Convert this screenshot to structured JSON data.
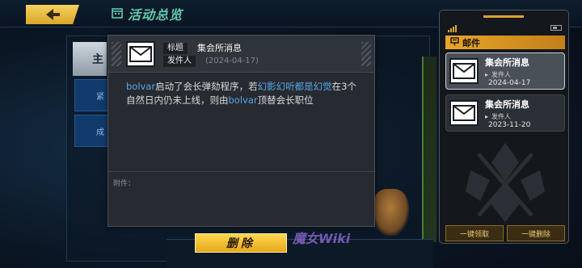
{
  "topbar": {
    "title": "活动总览"
  },
  "background": {
    "tab_label": "主",
    "button_one": "紧",
    "button_two": "成",
    "delete_label": "删除",
    "watermark": "魔女Wiki"
  },
  "dialog": {
    "subject_tag": "标题",
    "subject": "集会所消息",
    "sender_tag": "发件人",
    "date": "(2024-04-17)",
    "body_segments": [
      {
        "text": "bolvar",
        "highlight": true
      },
      {
        "text": "启动了会长弹劾程序，若",
        "highlight": false
      },
      {
        "text": "幻影幻听都是幻觉",
        "highlight": true
      },
      {
        "text": "在3个自然日内仍未上线，则由",
        "highlight": false
      },
      {
        "text": "bolvar",
        "highlight": true
      },
      {
        "text": "顶替会长职位",
        "highlight": false
      }
    ],
    "attachment_label": "附件："
  },
  "mail_panel": {
    "header": "邮件",
    "items": [
      {
        "subject": "集会所消息",
        "sender": "发件人",
        "date": "2024-04-17",
        "selected": true
      },
      {
        "subject": "集会所消息",
        "sender": "发件人",
        "date": "2023-11-20",
        "selected": false
      }
    ],
    "claim_all": "一键领取",
    "delete_all": "一键删除"
  },
  "colors": {
    "accent": "#e8a52a",
    "highlight_text": "#58a6e8",
    "title_teal": "#5fc9b0"
  },
  "icons": [
    "back-arrow-icon",
    "calendar-icon",
    "envelope-icon",
    "signal-icon",
    "battery-icon",
    "mailbox-icon"
  ]
}
